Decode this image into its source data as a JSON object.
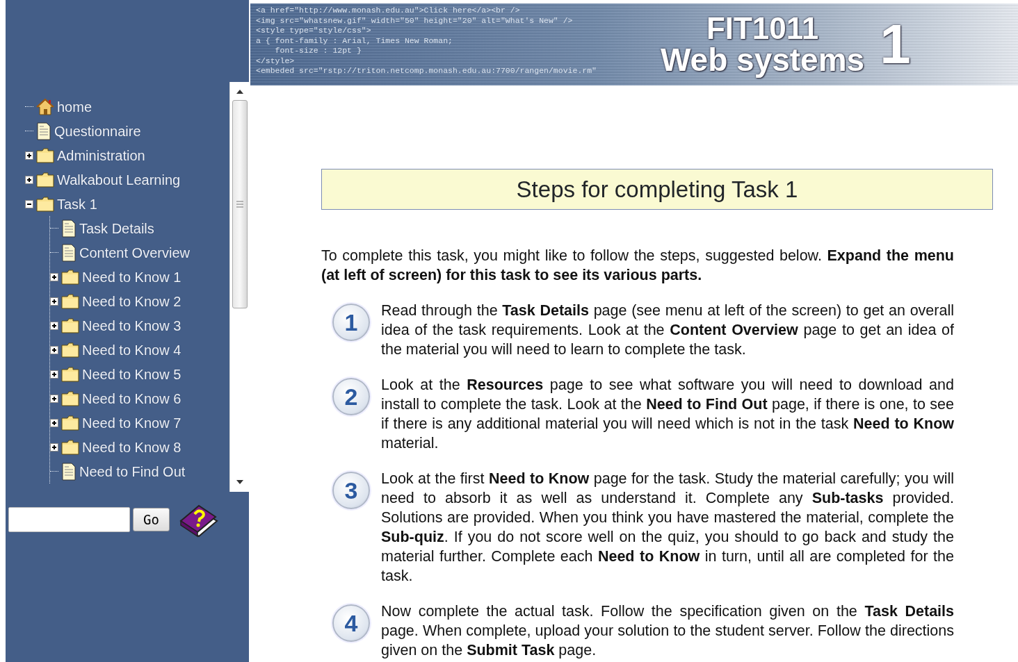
{
  "banner": {
    "code_lines": [
      "<a href=\"http://www.monash.edu.au\">Click here</a><br />",
      "<img src=\"whatsnew.gif\" width=\"50\" height=\"20\" alt=\"What's New\" />",
      "<style type=\"style/css\">",
      "a { font-family : Arial, Times New Roman;",
      "    font-size : 12pt }",
      "</style>",
      "<embeded src=\"rstp://triton.netcomp.monash.edu.au:7700/rangen/movie.rm\""
    ],
    "course_code": "FIT1011",
    "course_name": "Web systems",
    "number": "1"
  },
  "menu": [
    {
      "label": "home",
      "kind": "home"
    },
    {
      "label": "Questionnaire",
      "kind": "page"
    },
    {
      "label": "Administration",
      "kind": "folder",
      "expanded": false
    },
    {
      "label": "Walkabout Learning",
      "kind": "folder",
      "expanded": false
    },
    {
      "label": "Task 1",
      "kind": "folder",
      "expanded": true,
      "children": [
        {
          "label": "Task Details",
          "kind": "page"
        },
        {
          "label": "Content Overview",
          "kind": "page"
        },
        {
          "label": "Need to Know 1",
          "kind": "folder",
          "expanded": false
        },
        {
          "label": "Need to Know 2",
          "kind": "folder",
          "expanded": false
        },
        {
          "label": "Need to Know 3",
          "kind": "folder",
          "expanded": false
        },
        {
          "label": "Need to Know 4",
          "kind": "folder",
          "expanded": false
        },
        {
          "label": "Need to Know 5",
          "kind": "folder",
          "expanded": false
        },
        {
          "label": "Need to Know 6",
          "kind": "folder",
          "expanded": false
        },
        {
          "label": "Need to Know 7",
          "kind": "folder",
          "expanded": false
        },
        {
          "label": "Need to Know 8",
          "kind": "folder",
          "expanded": false
        },
        {
          "label": "Need to Find Out",
          "kind": "page"
        }
      ]
    }
  ],
  "search": {
    "button": "Go"
  },
  "heading": "Steps for completing Task 1",
  "intro": "To complete this task, you might like to follow the steps, suggested below. **Expand the menu (at left of screen) for this task to see its various parts.**",
  "steps": [
    {
      "number": "1",
      "text": "Read through the **Task Details** page (see menu at left of the screen) to get an overall idea of the task requirements. Look at the **Content Overview** page to get an idea of the material you will need to learn to complete the task."
    },
    {
      "number": "2",
      "text": "Look at the **Resources** page to see what software you will need to download and install to complete the task. Look at the **Need to Find Out** page, if there is one, to see if there is any additional material you will need which is not in the task **Need to Know** material."
    },
    {
      "number": "3",
      "text": "Look at the first **Need to Know** page for the task. Study the material carefully; you will need to absorb it as well as understand it. Complete any **Sub-tasks** provided. Solutions are provided. When you think you have mastered the material, complete the **Sub-quiz**. If you do not score well on the quiz, you should to go back and study the material further. Complete each **Need to Know** in turn, until all are completed for the task."
    },
    {
      "number": "4",
      "text": "Now complete the actual task. Follow the specification given on the **Task Details** page. When complete, upload your solution to the student server. Follow the directions given on the **Submit Task** page."
    }
  ]
}
